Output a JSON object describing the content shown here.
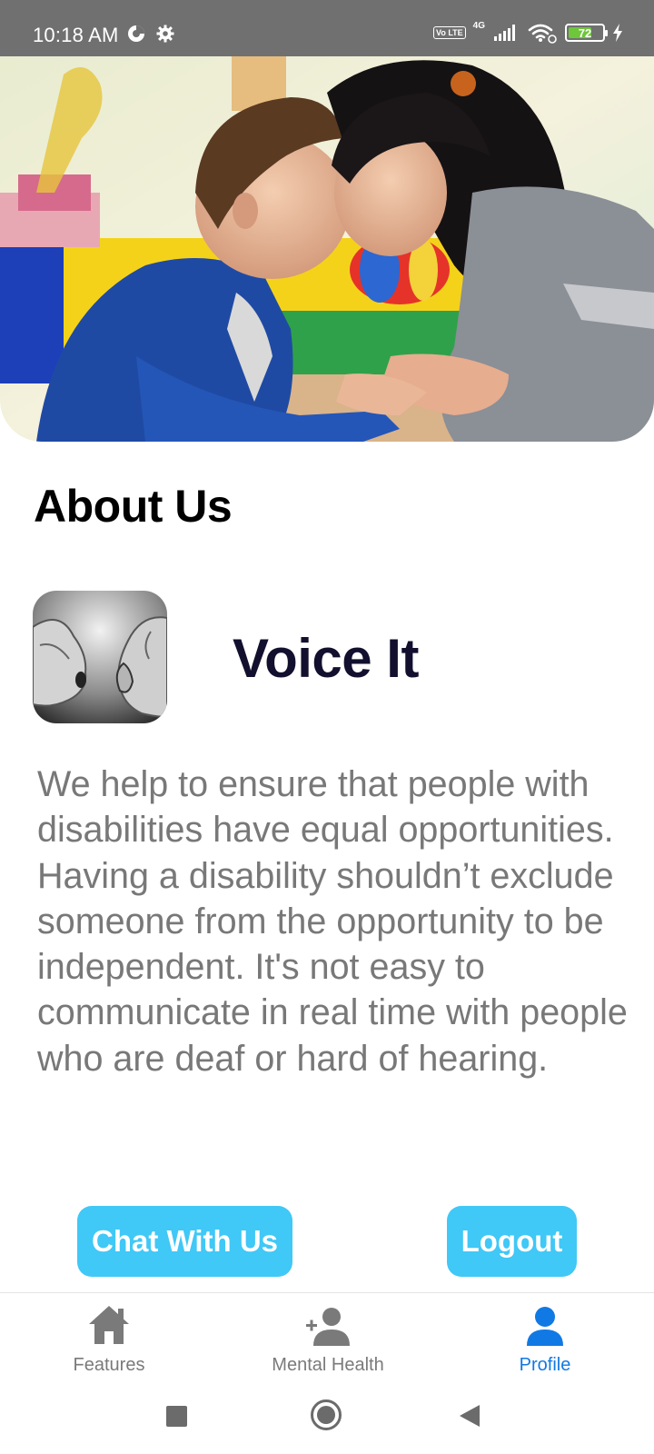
{
  "status_bar": {
    "time": "10:18 AM",
    "left_icons": [
      "data-saver-icon",
      "settings-gear-icon"
    ],
    "volte": "Vo LTE",
    "network": "4G",
    "battery_percent": "72",
    "battery_level": 0.72,
    "right_icons": [
      "signal-icon",
      "wifi-icon",
      "charging-bolt-icon"
    ]
  },
  "hero": {
    "image": "photo-caregiver-with-child"
  },
  "about": {
    "title": "About Us"
  },
  "app": {
    "logo": "voice-it-logo-ear-mouth",
    "name": "Voice It"
  },
  "description": {
    "text": "We help to ensure that people with disabilities have equal opportunities. Having a disability shouldn’t exclude someone from the opportunity to be independent. It's not easy to communicate in real time with people who are deaf or hard of hearing."
  },
  "actions": {
    "chat_label": "Chat With Us",
    "logout_label": "Logout",
    "button_color": "#40c8f6"
  },
  "bottom_nav": {
    "items": [
      {
        "label": "Features",
        "icon": "home-icon",
        "active": false
      },
      {
        "label": "Mental Health",
        "icon": "add-person-icon",
        "active": false
      },
      {
        "label": "Profile",
        "icon": "person-icon",
        "active": true
      }
    ],
    "active_color": "#1179e3",
    "inactive_color": "#7a7a7a"
  },
  "system_nav": {
    "buttons": [
      "recents-square-icon",
      "home-circle-icon",
      "back-triangle-icon"
    ]
  }
}
